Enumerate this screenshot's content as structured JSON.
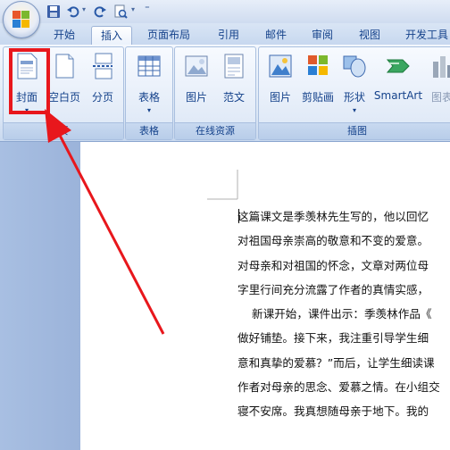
{
  "title_bar": {
    "qat_icons": [
      "save-icon",
      "undo-icon",
      "redo-icon",
      "print-preview-icon",
      "qat-dropdown-icon"
    ]
  },
  "tabs": [
    {
      "label": "开始",
      "active": false
    },
    {
      "label": "插入",
      "active": true
    },
    {
      "label": "页面布局",
      "active": false
    },
    {
      "label": "引用",
      "active": false
    },
    {
      "label": "邮件",
      "active": false
    },
    {
      "label": "审阅",
      "active": false
    },
    {
      "label": "视图",
      "active": false
    },
    {
      "label": "开发工具",
      "active": false
    }
  ],
  "ribbon": {
    "groups": [
      {
        "label": "页",
        "buttons": [
          {
            "label": "封面",
            "icon": "cover-page-icon",
            "dropdown": true
          },
          {
            "label": "空白页",
            "icon": "blank-page-icon",
            "dropdown": false
          },
          {
            "label": "分页",
            "icon": "page-break-icon",
            "dropdown": false
          }
        ]
      },
      {
        "label": "表格",
        "buttons": [
          {
            "label": "表格",
            "icon": "table-icon",
            "dropdown": true
          }
        ]
      },
      {
        "label": "在线资源",
        "buttons": [
          {
            "label": "图片",
            "icon": "online-picture-icon",
            "dropdown": false
          },
          {
            "label": "范文",
            "icon": "template-icon",
            "dropdown": false
          }
        ]
      },
      {
        "label": "插图",
        "buttons": [
          {
            "label": "图片",
            "icon": "picture-icon",
            "dropdown": false
          },
          {
            "label": "剪贴画",
            "icon": "clip-art-icon",
            "dropdown": false
          },
          {
            "label": "形状",
            "icon": "shapes-icon",
            "dropdown": true
          },
          {
            "label": "SmartArt",
            "icon": "smartart-icon",
            "dropdown": false
          },
          {
            "label": "图表",
            "icon": "chart-icon",
            "dropdown": false
          }
        ]
      }
    ]
  },
  "document": {
    "lines": [
      "这篇课文是季羡林先生写的，他以回忆",
      "对祖国母亲崇高的敬意和不变的爱意。",
      "对母亲和对祖国的怀念，文章对两位母",
      "字里行间充分流露了作者的真情实感，",
      "    新课开始，课件出示：季羡林作品《",
      "做好铺垫。接下来，我注重引导学生细",
      "意和真挚的爱慕？”而后，让学生细读课",
      "作者对母亲的思念、爱慕之情。在小组交",
      "寝不安席。我真想随母亲于地下。我的"
    ]
  },
  "colors": {
    "annotation_red": "#e8171c",
    "ribbon_text": "#15428b"
  }
}
